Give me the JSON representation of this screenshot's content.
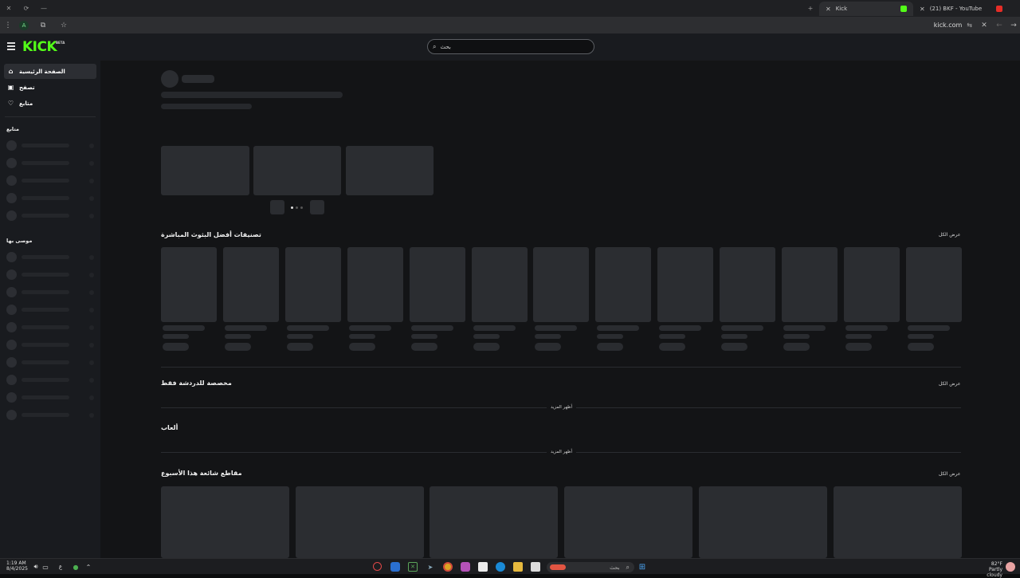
{
  "browser": {
    "tabs": [
      {
        "title": "Kick",
        "close": "✕"
      },
      {
        "title": "(21) BKF - YouTube",
        "close": "✕"
      }
    ],
    "new_tab": "+",
    "profile_letter": "A",
    "url": "kick.com"
  },
  "header": {
    "logo": "KICK",
    "logo_badge": "BETA",
    "search_placeholder": "بحث"
  },
  "sidebar": {
    "nav": [
      {
        "label": "الصفحة الرئيسية",
        "icon": "home-icon"
      },
      {
        "label": "تصفح",
        "icon": "browse-icon"
      },
      {
        "label": "متابع",
        "icon": "heart-icon"
      }
    ],
    "following_heading": "متابع",
    "recommended_heading": "موصى بها"
  },
  "main": {
    "sections": {
      "top_live": {
        "title": "تصنيفات أفضل البثوث المباشرة",
        "see_all": "عرض الكل"
      },
      "chat_only": {
        "title": "مخصصة للدردشة فقط",
        "see_all": "عرض الكل",
        "more": "أظهر المزيد"
      },
      "games": {
        "title": "ألعاب",
        "more": "أظهر المزيد"
      },
      "clips": {
        "title": "مقاطع شائعة هذا الأسبوع",
        "see_all": "عرض الكل"
      }
    }
  },
  "taskbar": {
    "time": "1:19 AM",
    "date": "8/4/2025",
    "lang": "ع",
    "search_text": "بحث",
    "temperature": "82°F",
    "weather": "Partly cloudy"
  },
  "colors": {
    "brand": "#53fc18",
    "accent": "#3f7cd6"
  }
}
